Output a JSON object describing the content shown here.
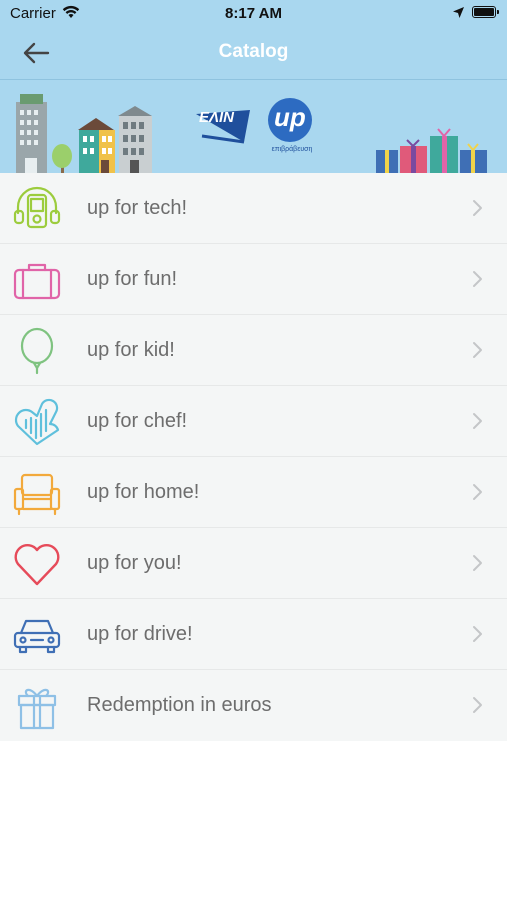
{
  "status_bar": {
    "carrier": "Carrier",
    "time": "8:17 AM"
  },
  "nav": {
    "title": "Catalog",
    "back_icon": "arrow-left-icon"
  },
  "banner": {
    "logo_left": "ΕΛΙΝ",
    "logo_right": "up",
    "logo_right_caption": "επιβράβευση"
  },
  "items": [
    {
      "label": "up for tech!",
      "icon": "headphones-phone-icon",
      "color": "#9ccc3d"
    },
    {
      "label": "up for fun!",
      "icon": "suitcase-icon",
      "color": "#e064a8"
    },
    {
      "label": "up for kid!",
      "icon": "balloon-icon",
      "color": "#7fc380"
    },
    {
      "label": "up for chef!",
      "icon": "oven-mitt-icon",
      "color": "#5fc0dc"
    },
    {
      "label": "up for home!",
      "icon": "armchair-icon",
      "color": "#f2a93b"
    },
    {
      "label": "up for you!",
      "icon": "heart-icon",
      "color": "#e64b5a"
    },
    {
      "label": "up for drive!",
      "icon": "car-icon",
      "color": "#3f6fb5"
    },
    {
      "label": "Redemption in euros",
      "icon": "gift-icon",
      "color": "#8ec0e6"
    }
  ]
}
